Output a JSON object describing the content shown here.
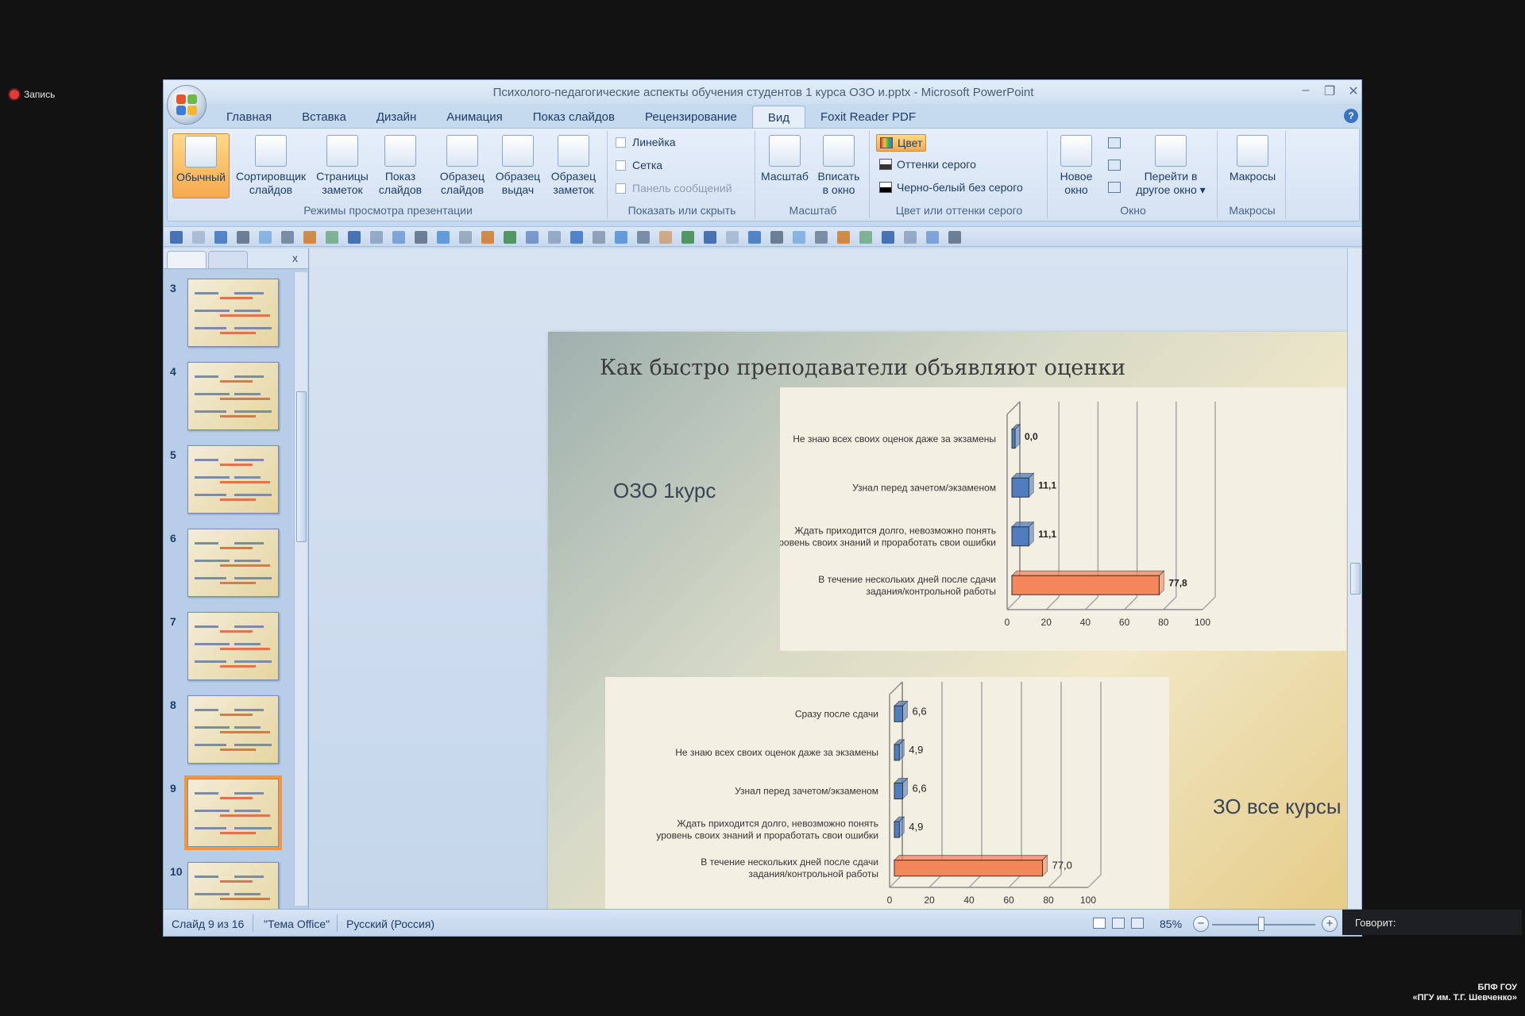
{
  "recording": {
    "label": "Запись"
  },
  "window": {
    "title": "Психолого-педагогические аспекты обучения студентов 1 курса ОЗО и.pptx - Microsoft PowerPoint",
    "controls": [
      "–",
      "❐",
      "✕"
    ]
  },
  "tabs": [
    "Главная",
    "Вставка",
    "Дизайн",
    "Анимация",
    "Показ слайдов",
    "Рецензирование",
    "Вид",
    "Foxit Reader PDF"
  ],
  "active_tab": "Вид",
  "ribbon": {
    "views": {
      "label": "Режимы просмотра презентации",
      "buttons": [
        {
          "line1": "Обычный",
          "line2": ""
        },
        {
          "line1": "Сортировщик",
          "line2": "слайдов"
        },
        {
          "line1": "Страницы",
          "line2": "заметок"
        },
        {
          "line1": "Показ",
          "line2": "слайдов"
        },
        {
          "line1": "Образец",
          "line2": "слайдов"
        },
        {
          "line1": "Образец",
          "line2": "выдач"
        },
        {
          "line1": "Образец",
          "line2": "заметок"
        }
      ]
    },
    "show": {
      "label": "Показать или скрыть",
      "items": [
        "Линейка",
        "Сетка",
        "Панель сообщений"
      ]
    },
    "zoom": {
      "label": "Масштаб",
      "buttons": [
        {
          "line1": "Масштаб",
          "line2": ""
        },
        {
          "line1": "Вписать",
          "line2": "в окно"
        }
      ]
    },
    "color": {
      "label": "Цвет или оттенки серого",
      "items": [
        "Цвет",
        "Оттенки серого",
        "Черно-белый без серого"
      ]
    },
    "window": {
      "label": "Окно",
      "buttons": [
        {
          "line1": "Новое",
          "line2": "окно"
        },
        {
          "line1": "Перейти в",
          "line2": "другое окно ▾"
        }
      ]
    },
    "macros": {
      "label": "Макросы",
      "buttons": [
        {
          "line1": "Макросы",
          "line2": ""
        }
      ]
    }
  },
  "thumbnails": {
    "numbers": [
      "3",
      "4",
      "5",
      "6",
      "7",
      "8",
      "9",
      "10"
    ],
    "selected": "9",
    "close": "x"
  },
  "slide": {
    "title": "Как быстро преподаватели объявляют оценки",
    "label_top": "ОЗО  1курс",
    "label_bottom": "ЗО  все курсы"
  },
  "chart_data": [
    {
      "type": "bar",
      "orientation": "horizontal",
      "categories": [
        "Не знаю всех своих оценок даже за экзамены",
        "Узнал перед зачетом/экзаменом",
        "Ждать приходится долго, невозможно понять уровень своих знаний и проработать свои ошибки",
        "В течение нескольких дней после сдачи задания/контрольной работы"
      ],
      "category_lines": [
        [
          "Не знаю всех своих оценок даже за экзамены"
        ],
        [
          "Узнал перед зачетом/экзаменом"
        ],
        [
          "Ждать приходится долго, невозможно понять",
          "уровень своих знаний и проработать свои ошибки"
        ],
        [
          "В течение нескольких дней после сдачи",
          "задания/контрольной  работы"
        ]
      ],
      "values": [
        0.0,
        11.1,
        11.1,
        77.8
      ],
      "value_labels": [
        "0,0",
        "11,1",
        "11,1",
        "77,8"
      ],
      "xlim": [
        0,
        100
      ],
      "xticks": [
        "0",
        "20",
        "40",
        "60",
        "80",
        "100"
      ],
      "bar_colors": [
        "#4f7dbf",
        "#4f7dbf",
        "#4f7dbf",
        "#f5855a"
      ],
      "grid": true
    },
    {
      "type": "bar",
      "orientation": "horizontal",
      "categories": [
        "Сразу после сдачи",
        "Не знаю всех своих оценок даже за экзамены",
        "Узнал перед зачетом/экзаменом",
        "Ждать приходится долго, невозможно понять уровень своих знаний и проработать свои ошибки",
        "В течение нескольких дней после сдачи задания/контрольной работы"
      ],
      "category_lines": [
        [
          "Сразу после сдачи"
        ],
        [
          "Не знаю всех своих оценок даже за экзамены"
        ],
        [
          "Узнал перед зачетом/экзаменом"
        ],
        [
          "Ждать приходится долго, невозможно понять",
          "уровень своих знаний и проработать свои ошибки"
        ],
        [
          "В течение нескольких дней после сдачи",
          "задания/контрольной  работы"
        ]
      ],
      "values": [
        6.6,
        4.9,
        6.6,
        4.9,
        77.0
      ],
      "value_labels": [
        "6,6",
        "4,9",
        "6,6",
        "4,9",
        "77,0"
      ],
      "xlim": [
        0,
        100
      ],
      "xticks": [
        "0",
        "20",
        "40",
        "60",
        "80",
        "100"
      ],
      "bar_colors": [
        "#4f7dbf",
        "#4f7dbf",
        "#4f7dbf",
        "#4f7dbf",
        "#f5855a"
      ],
      "grid": true
    }
  ],
  "status": {
    "slide": "Слайд 9 из 16",
    "theme": "\"Тема Office\"",
    "language": "Русский (Россия)",
    "zoom": "85%",
    "minus": "−",
    "plus": "+"
  },
  "speaking": {
    "label": "Говорит:"
  },
  "org": {
    "line1": "БПФ ГОУ",
    "line2": "«ПГУ им. Т.Г. Шевченко»"
  }
}
